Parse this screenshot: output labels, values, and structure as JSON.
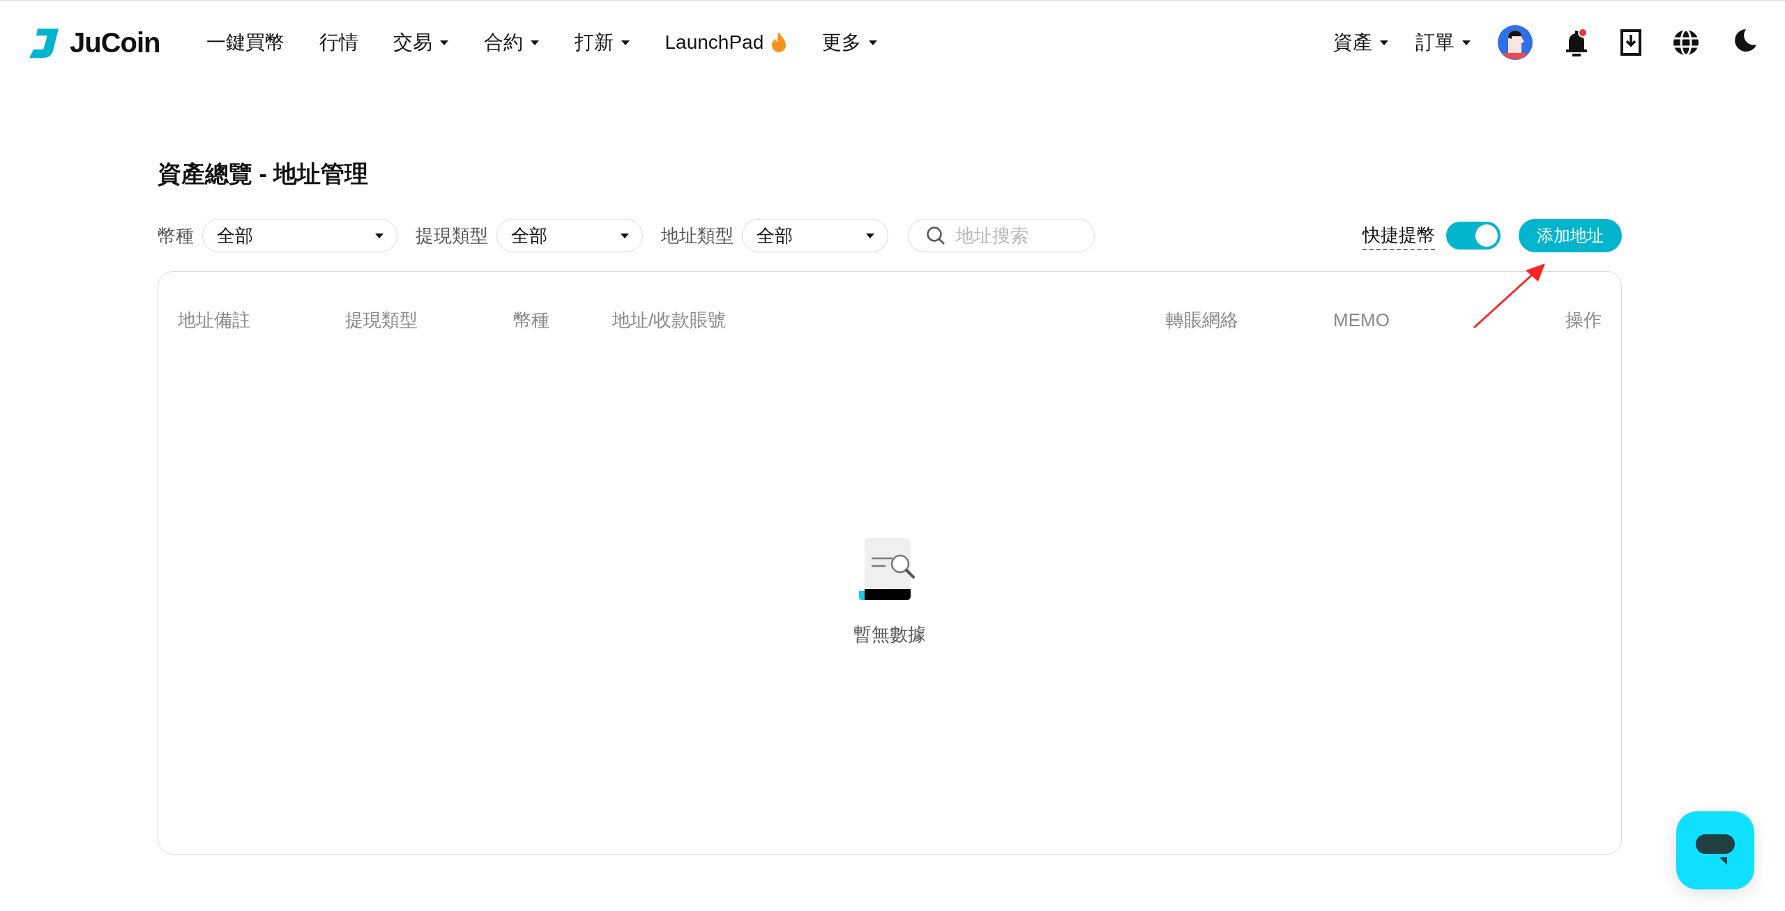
{
  "header": {
    "logo": "JuCoin",
    "nav": [
      {
        "label": "一鍵買幣",
        "dropdown": false,
        "hot": false
      },
      {
        "label": "行情",
        "dropdown": false,
        "hot": false
      },
      {
        "label": "交易",
        "dropdown": true,
        "hot": false
      },
      {
        "label": "合約",
        "dropdown": true,
        "hot": false
      },
      {
        "label": "打新",
        "dropdown": true,
        "hot": false
      },
      {
        "label": "LaunchPad",
        "dropdown": false,
        "hot": true
      },
      {
        "label": "更多",
        "dropdown": true,
        "hot": false
      }
    ],
    "right_menus": [
      {
        "label": "資產"
      },
      {
        "label": "訂單"
      }
    ],
    "notifications_unread": true
  },
  "page_title": "資產總覽 - 地址管理",
  "filters": [
    {
      "label": "幣種",
      "value": "全部"
    },
    {
      "label": "提現類型",
      "value": "全部"
    },
    {
      "label": "地址類型",
      "value": "全部"
    }
  ],
  "search": {
    "placeholder": "地址搜索"
  },
  "quick_withdraw": {
    "label": "快捷提幣",
    "on": true
  },
  "add_button": "添加地址",
  "table": {
    "columns": [
      "地址備註",
      "提現類型",
      "幣種",
      "地址/收款賬號",
      "轉賬網絡",
      "MEMO",
      "操作"
    ],
    "empty_text": "暫無數據"
  }
}
